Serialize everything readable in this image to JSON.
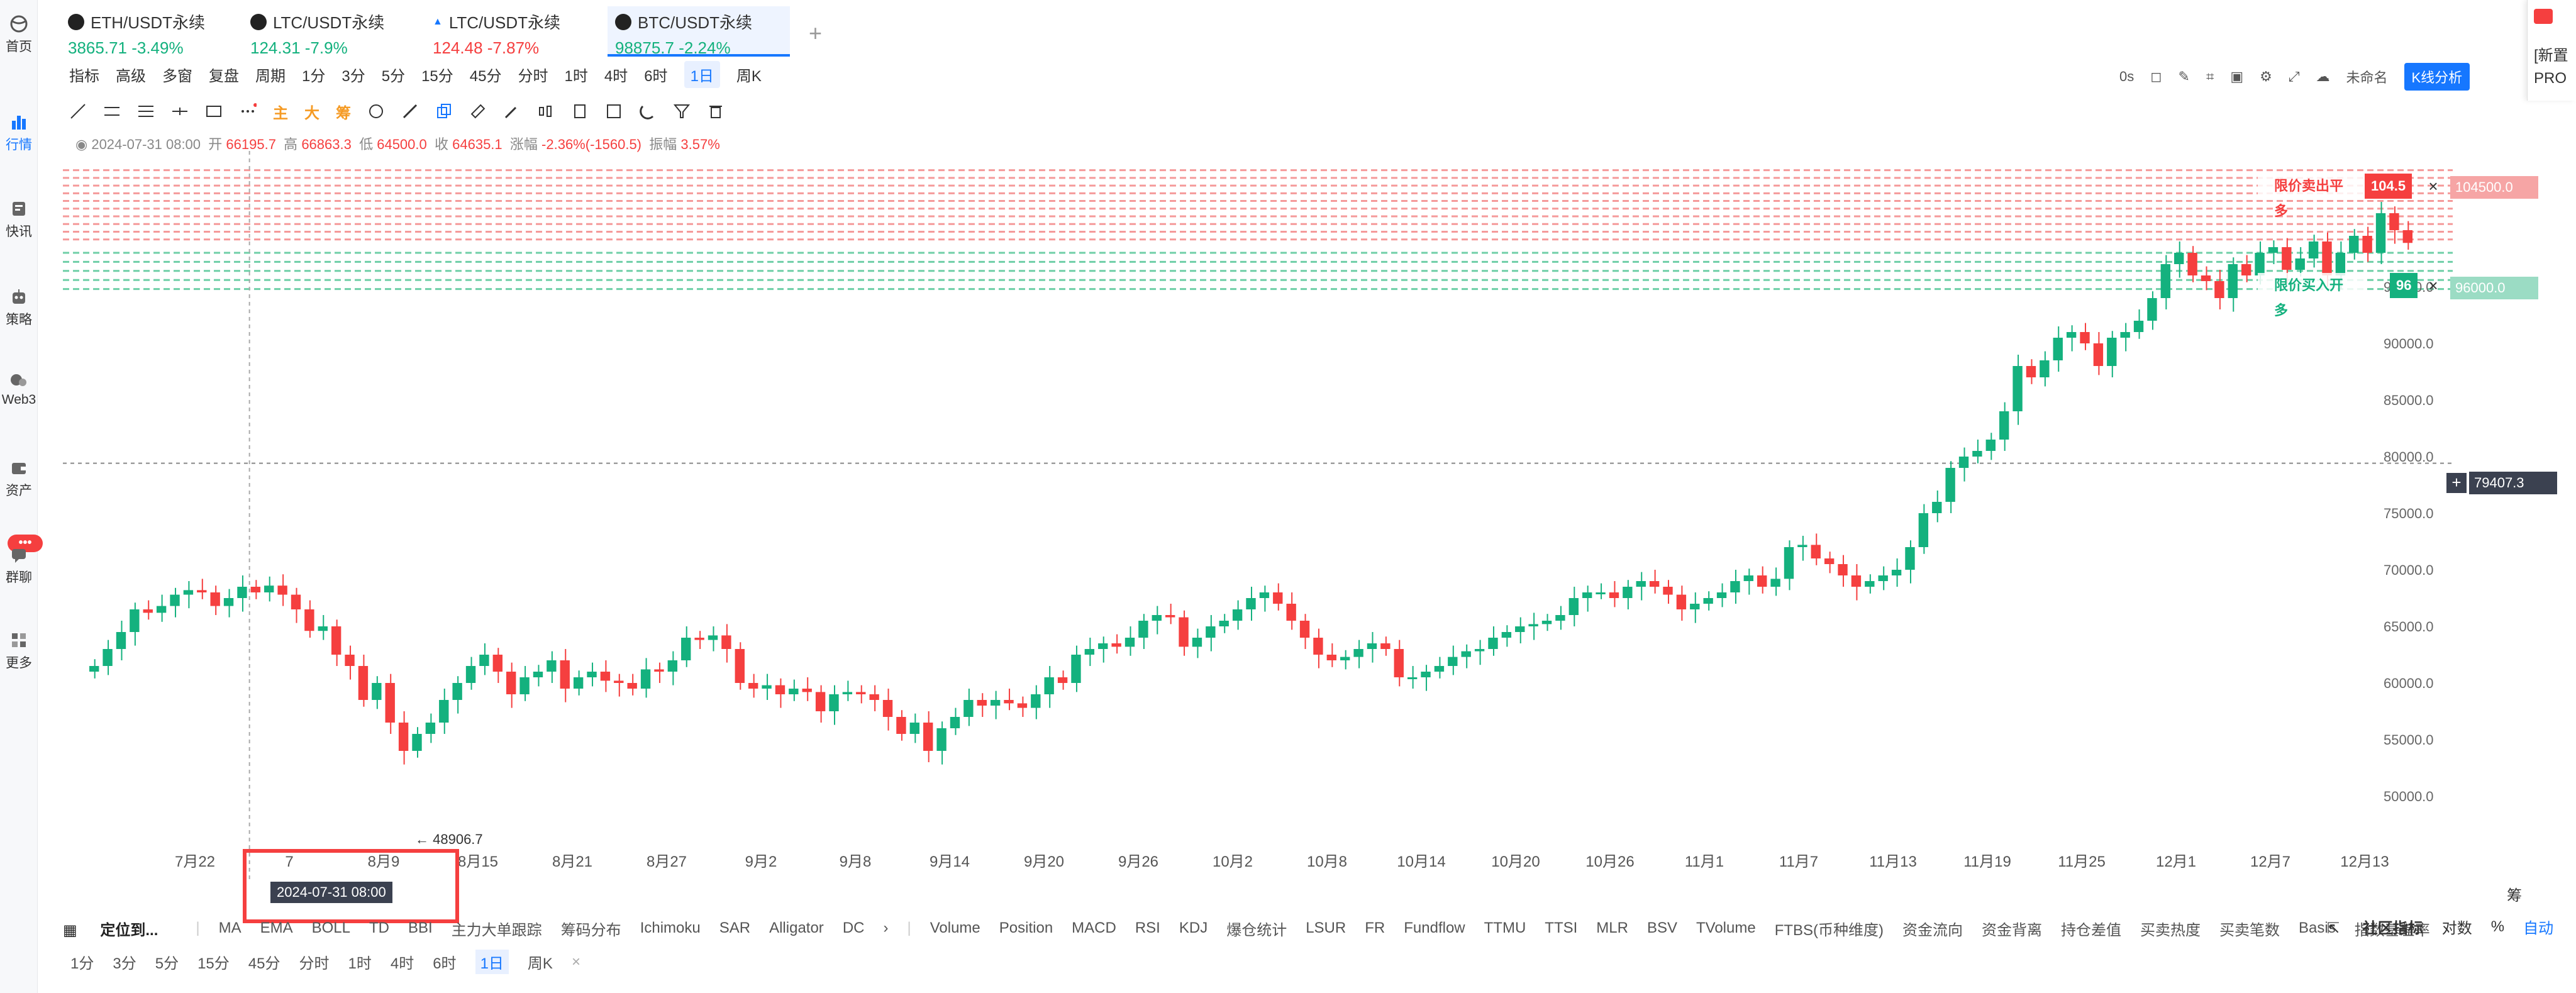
{
  "sidebar": {
    "items": [
      {
        "label": "首页"
      },
      {
        "label": "行情"
      },
      {
        "label": "快讯"
      },
      {
        "label": "策略"
      },
      {
        "label": "Web3"
      },
      {
        "label": "资产"
      },
      {
        "label": "群聊"
      },
      {
        "label": "更多"
      }
    ],
    "badge": "•••"
  },
  "tabs": [
    {
      "name": "ETH/USDT永续",
      "price": "3865.71",
      "change": "-3.49%",
      "price_color": "up"
    },
    {
      "name": "LTC/USDT永续",
      "price": "124.31",
      "change": "-7.9%",
      "price_color": "up"
    },
    {
      "name": "LTC/USDT永续",
      "price": "124.48",
      "change": "-7.87%",
      "price_color": "down"
    },
    {
      "name": "BTC/USDT永续",
      "price": "98875.7",
      "change": "-2.24%",
      "price_color": "up"
    }
  ],
  "toolbar": {
    "items": [
      "指标",
      "高级",
      "多窗",
      "复盘",
      "周期",
      "1分",
      "3分",
      "5分",
      "15分",
      "45分",
      "分时",
      "1时",
      "4时",
      "6时",
      "1日",
      "周K"
    ],
    "selected": "1日"
  },
  "drawing_tools": {
    "main": "主",
    "big": "大",
    "chip": "筹"
  },
  "right_tools": {
    "zero_s": "0s",
    "unnamed": "未命名",
    "kline_btn": "K线分析"
  },
  "ohlc": {
    "date": "2024-07-31 08:00",
    "open_label": "开",
    "open": "66195.7",
    "high_label": "高",
    "high": "66863.3",
    "low_label": "低",
    "low": "64500.0",
    "close_label": "收",
    "close": "64635.1",
    "chg_label": "涨幅",
    "chg": "-2.36%(-1560.5)",
    "amp_label": "振幅",
    "amp": "3.57%"
  },
  "chart_data": {
    "type": "candlestick",
    "x_ticks": [
      "7月22",
      "7",
      "8月9",
      "8月15",
      "8月21",
      "8月27",
      "9月2",
      "9月8",
      "9月14",
      "9月20",
      "9月26",
      "10月2",
      "10月8",
      "10月14",
      "10月20",
      "10月26",
      "11月1",
      "11月7",
      "11月13",
      "11月19",
      "11月25",
      "12月1",
      "12月7",
      "12月13"
    ],
    "y_ticks": [
      50000,
      55000,
      60000,
      65000,
      70000,
      75000,
      80000,
      85000,
      90000,
      95000
    ],
    "ylim": [
      47000,
      107000
    ],
    "closes": [
      61500,
      63000,
      64500,
      66500,
      66200,
      66800,
      67800,
      68200,
      68000,
      66800,
      67500,
      68500,
      68000,
      68600,
      67800,
      66500,
      64600,
      65000,
      62500,
      61500,
      58500,
      60000,
      56500,
      54000,
      55500,
      56500,
      58500,
      60000,
      61500,
      62500,
      61000,
      59000,
      60500,
      61000,
      62000,
      59500,
      60500,
      61000,
      60200,
      60000,
      59500,
      61200,
      61000,
      62000,
      64000,
      63800,
      64200,
      63000,
      60000,
      59500,
      59800,
      59000,
      59500,
      59200,
      57500,
      59000,
      59200,
      59000,
      58500,
      57000,
      55500,
      56500,
      54000,
      56000,
      57000,
      58500,
      58000,
      58500,
      58200,
      57800,
      59000,
      60500,
      60000,
      62500,
      63000,
      63500,
      63200,
      64000,
      65500,
      66000,
      65800,
      63200,
      64000,
      65000,
      65500,
      66500,
      67500,
      68000,
      67000,
      65500,
      64000,
      62500,
      62000,
      62300,
      63000,
      63500,
      63000,
      60500,
      60500,
      61000,
      61500,
      62300,
      62800,
      63000,
      64000,
      64500,
      65000,
      65200,
      65500,
      66000,
      67500,
      68000,
      68000,
      67500,
      68500,
      69000,
      68500,
      67800,
      66500,
      67000,
      67500,
      68000,
      69000,
      69500,
      68500,
      69200,
      72000,
      72200,
      71000,
      70500,
      69500,
      68500,
      69000,
      69500,
      70000,
      72000,
      75000,
      76000,
      79000,
      80000,
      80500,
      81500,
      84000,
      88000,
      87000,
      88500,
      90500,
      91000,
      90000,
      88000,
      90500,
      91000,
      92000,
      94000,
      97000,
      98000,
      96000,
      95500,
      94000,
      97000,
      96000,
      98000,
      98500,
      96500,
      97500,
      99000,
      96000,
      98000,
      99500,
      98000,
      101500,
      100000,
      98875
    ],
    "crosshair_price": "79407.3",
    "crosshair_x_label": "2024-07-31 08:00",
    "low_marker": "48906.7",
    "sell_price": "104500.0",
    "buy_price": "96000.0",
    "sell_order": {
      "label": "限价卖出平多",
      "value": "104.5"
    },
    "buy_order": {
      "label": "限价买入开多",
      "value": "96"
    }
  },
  "indicators": {
    "locate": "定位到...",
    "main": [
      "MA",
      "EMA",
      "BOLL",
      "TD",
      "BBI",
      "主力大单跟踪",
      "筹码分布",
      "Ichimoku",
      "SAR",
      "Alligator",
      "DC"
    ],
    "sub": [
      "Volume",
      "Position",
      "MACD",
      "RSI",
      "KDJ",
      "爆仓统计",
      "LSUR",
      "FR",
      "Fundflow",
      "TTMU",
      "TTSI",
      "MLR",
      "BSV",
      "TVolume",
      "FTBS(币种维度)",
      "资金流向",
      "资金背离",
      "持仓差值",
      "买卖热度",
      "买卖笔数",
      "Basis",
      "指数基差率"
    ],
    "community": "社区指标",
    "log": "对数",
    "pct": "%",
    "auto": "自动"
  },
  "period_row": {
    "items": [
      "1分",
      "3分",
      "5分",
      "15分",
      "45分",
      "分时",
      "1时",
      "4时",
      "6时",
      "1日",
      "周K"
    ],
    "selected": "1日"
  },
  "side_panel": {
    "line1": "[新置",
    "line2": "PRO"
  },
  "chou_label": "筹",
  "colors": {
    "up": "#14b17e",
    "down": "#f53f3f",
    "accent": "#1677ff",
    "sell_zone": "#f8c6c6",
    "buy_zone": "#b5e8d4"
  }
}
